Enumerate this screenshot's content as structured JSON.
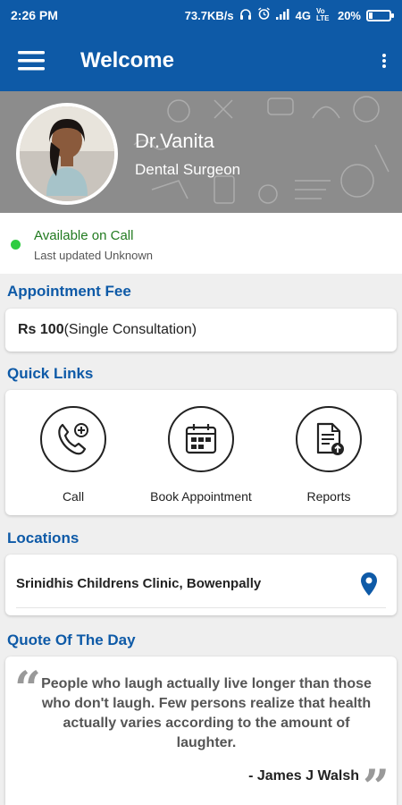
{
  "status_bar": {
    "time": "2:26 PM",
    "net_speed": "73.7KB/s",
    "network": "4G",
    "volte": "Vo LTE",
    "battery": "20%",
    "battery_level": 0.2
  },
  "app_bar": {
    "title": "Welcome",
    "menu_icon": "hamburger-menu-icon",
    "more_icon": "overflow-menu-icon"
  },
  "profile": {
    "name": "Dr.Vanita",
    "specialty": "Dental Surgeon"
  },
  "availability": {
    "status": "Available on Call",
    "updated": "Last updated Unknown",
    "color": "#2ecc40"
  },
  "appointment_fee": {
    "title": "Appointment Fee",
    "amount": "Rs 100",
    "description": "(Single Consultation)"
  },
  "quick_links": {
    "title": "Quick Links",
    "items": [
      {
        "label": "Call",
        "icon": "phone-add-icon"
      },
      {
        "label": "Book Appointment",
        "icon": "calendar-icon"
      },
      {
        "label": "Reports",
        "icon": "report-upload-icon"
      }
    ]
  },
  "locations": {
    "title": "Locations",
    "items": [
      {
        "name": "Srinidhis Childrens Clinic, Bowenpally",
        "icon": "map-pin-icon"
      }
    ]
  },
  "quote": {
    "title": "Quote Of The Day",
    "text": "People who laugh actually live longer than those who don't laugh. Few persons realize that health actually varies according to the amount of laughter.",
    "author": "- James J Walsh"
  },
  "colors": {
    "primary": "#0e5aa7",
    "accent_green": "#217a1f"
  }
}
